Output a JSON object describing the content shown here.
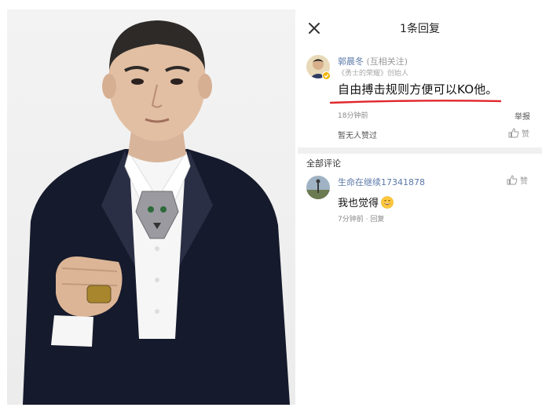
{
  "dialog": {
    "title": "1条回复",
    "close_icon": "close-icon"
  },
  "post": {
    "author": "郭晨冬",
    "relation": "(互相关注)",
    "subtitle": "《勇士的荣耀》创始人",
    "text": "自由搏击规则方便可以KO他。",
    "time": "18分钟前",
    "report_label": "举报",
    "no_likes": "暂无人赞过",
    "like_label": "赞",
    "underline_color": "#e0262b"
  },
  "comments_section": {
    "title": "全部评论",
    "items": [
      {
        "user": "生命在继续17341878",
        "text": "我也觉得",
        "emoji": "grinning-face-emoji",
        "time": "7分钟前",
        "separator": "·",
        "reply_label": "回复",
        "like_label": "赞"
      }
    ]
  },
  "colors": {
    "link_blue": "#5a78a8",
    "suit": "#151a2c",
    "background": "#f3f3f3"
  }
}
